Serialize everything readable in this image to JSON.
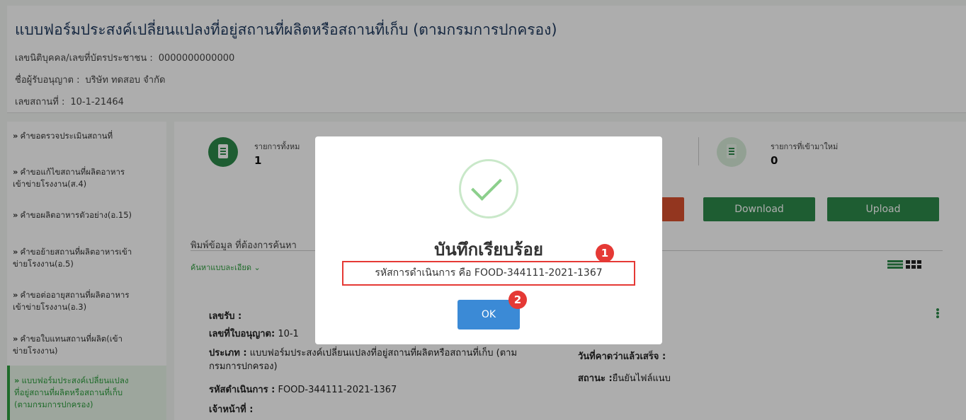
{
  "header": {
    "title": "แบบฟอร์มประสงค์เปลี่ยนแปลงที่อยู่สถานที่ผลิตหรือสถานที่เก็บ (ตามกรมการปกครอง)",
    "id_label": "เลขนิติบุคคล/เลขที่บัตรประชาชน :",
    "id_value": "0000000000000",
    "licensee_label": "ชื่อผู้รับอนุญาต :",
    "licensee_value": "บริษัท ทดสอบ จำกัด",
    "place_label": "เลขสถานที่ :",
    "place_value": "10-1-21464"
  },
  "sidebar": {
    "arrow": "»",
    "items": [
      {
        "label": "คำขอตรวจประเมินสถานที่"
      },
      {
        "label": "คำขอแก้ไขสถานที่ผลิตอาหาร",
        "label2": "เข้าข่ายโรงงาน(ส.4)"
      },
      {
        "label": "คำขอผลิตอาหารตัวอย่าง(อ.15)"
      },
      {
        "label": "คำขอย้ายสถานที่ผลิตอาหารเข้า",
        "label2": "ข่ายโรงงาน(อ.5)"
      },
      {
        "label": "คำขอต่ออายุสถานที่ผลิตอาหาร",
        "label2": "เข้าข่ายโรงงาน(อ.3)"
      },
      {
        "label": "คำขอใบแทนสถานที่ผลิต(เข้า",
        "label2": "ข่ายโรงงาน)"
      },
      {
        "label": "แบบฟอร์มประสงค์เปลี่ยนแปลง",
        "label2": "ที่อยู่สถานที่ผลิตหรือสถานที่เก็บ",
        "label3": "(ตามกรมการปกครอง)"
      }
    ]
  },
  "stats": {
    "total_label": "รายการทั้งหม",
    "total_value": "1",
    "new_label": "รายการที่เข้ามาใหม่",
    "new_value": "0"
  },
  "buttons": {
    "download": "Download",
    "upload": "Upload"
  },
  "search": {
    "label": "พิมพ์ข้อมูล ที่ต้องการค้นหา",
    "advanced": "ค้นหาแบบละเอียด ⌄"
  },
  "detail": {
    "receipt_label": "เลขรับ :",
    "license_label": "เลขที่ใบอนุญาต:",
    "license_value": "10-1",
    "type_label": "ประเภท :",
    "type_value": "แบบฟอร์มประสงค์เปลี่ยนแปลงที่อยู่สถานที่ผลิตหรือสถานที่เก็บ (ตาม",
    "type_value2": "กรมการปกครอง)",
    "code_label": "รหัสดำเนินการ :",
    "code_value": "FOOD-344111-2021-1367",
    "officer_label": "เจ้าหน้าที่ :",
    "due_label": "วันที่คาดว่าแล้วเสร็จ :",
    "status_label": "สถานะ :",
    "status_value": "ยืนยันไฟล์แนบ"
  },
  "modal": {
    "title": "บันทึกเรียบร้อย",
    "message": "รหัสการดำเนินการ คือ FOOD-344111-2021-1367",
    "ok": "OK",
    "badge1": "1",
    "badge2": "2"
  },
  "colors": {
    "primary_green": "#2d8a4a",
    "ok_blue": "#3b8ad6",
    "highlight_red": "#e53935"
  }
}
